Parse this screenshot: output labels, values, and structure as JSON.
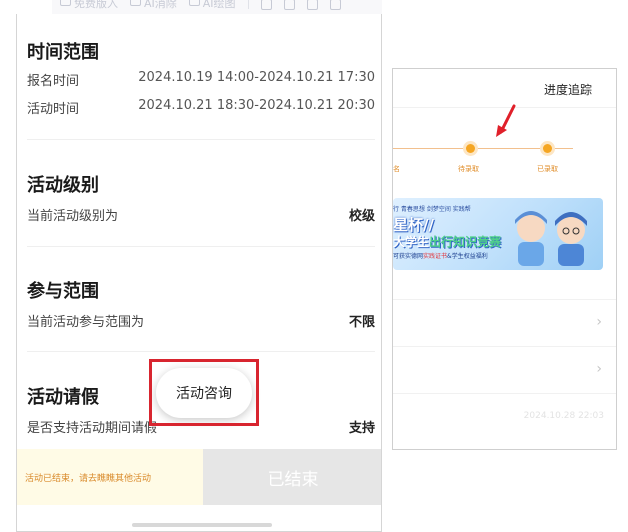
{
  "toolbar": {
    "items": [
      "免费版入",
      "AI消除",
      "AI绘图"
    ]
  },
  "left_panel": {
    "time_section": {
      "title": "时间范围",
      "signup_label": "报名时间",
      "signup_value": "2024.10.19 14:00-2024.10.21 17:30",
      "activity_label": "活动时间",
      "activity_value": "2024.10.21 18:30-2024.10.21 20:30"
    },
    "level_section": {
      "title": "活动级别",
      "label": "当前活动级别为",
      "value": "校级"
    },
    "scope_section": {
      "title": "参与范围",
      "label": "当前活动参与范围为",
      "value": "不限"
    },
    "leave_section": {
      "title": "活动请假",
      "label": "是否支持活动期间请假",
      "value": "支持"
    },
    "consult_button": "活动咨询",
    "notice": "活动已结束，请去瞧瞧其他活动",
    "ended_button": "已结束"
  },
  "right_panel": {
    "header": "进度追踪",
    "steps": [
      "名",
      "待录取",
      "已录取"
    ],
    "banner": {
      "top_text": "行 青春思想 剑梦空间 实践帮",
      "line1": "星杯//",
      "line2_prefix": "大学生",
      "line2_green": "出行知识竞赛",
      "sub_prefix": "可获实德网",
      "sub_red": "实践证书",
      "sub_suffix": "&学生权益福利"
    },
    "date": "2024.10.28 22:03"
  },
  "colors": {
    "highlight_red": "#d8252f",
    "progress_orange": "#f5a623",
    "notice_orange": "#d98a2b"
  }
}
